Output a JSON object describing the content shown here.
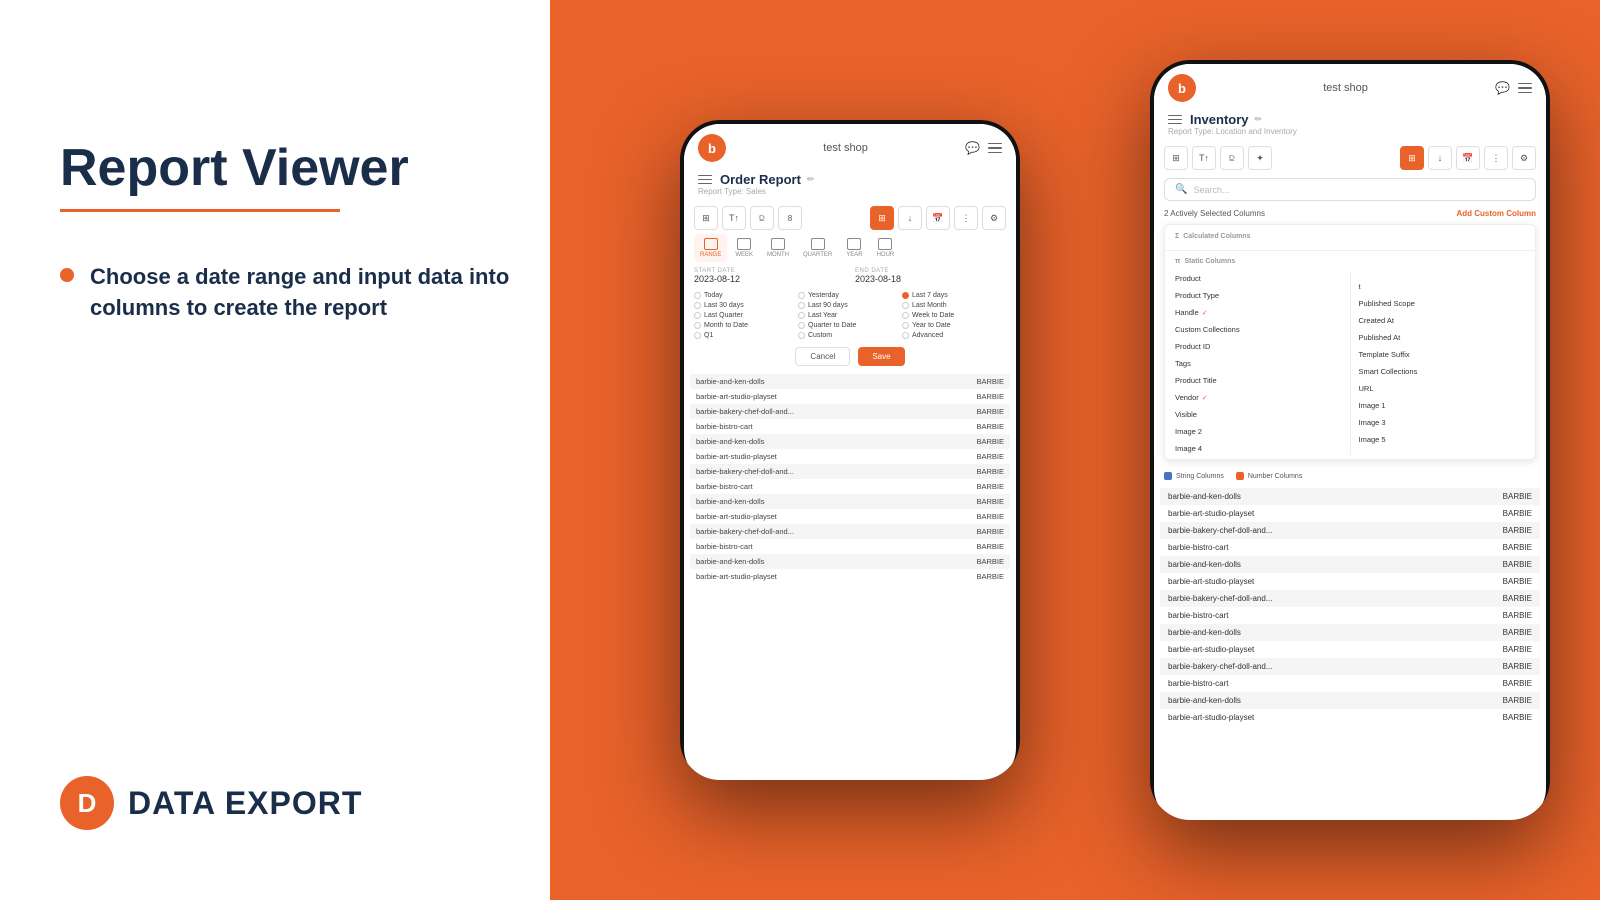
{
  "background": {
    "color": "#E8622A"
  },
  "left_panel": {
    "title": "Report Viewer",
    "underline_color": "#E8622A",
    "bullet": "Choose a date range and input data into columns to create the report",
    "logo_letter": "D",
    "logo_text": "DATA  EXPORT"
  },
  "phone_left": {
    "store_name": "test shop",
    "report_title": "Order Report",
    "report_subtitle": "Report Type: Sales",
    "toolbar_buttons": [
      "grid",
      "T",
      "filter",
      "8"
    ],
    "date_tabs": [
      "RANGE",
      "WEEK",
      "MONTH",
      "QUARTER",
      "YEAR",
      "HOUR"
    ],
    "start_date_label": "START DATE",
    "start_date_value": "2023-08-12",
    "end_date_label": "END DATE",
    "end_date_value": "2023-08-18",
    "radio_options": [
      [
        "Today",
        "Yesterday",
        "Last 7 days"
      ],
      [
        "Last 30 days",
        "Last 90 days",
        "Last Month"
      ],
      [
        "Last Quarter",
        "Last Year",
        "Week to Date"
      ],
      [
        "Month to Date",
        "Quarter to Date",
        "Year to Date"
      ],
      [
        "Q1",
        "Custom",
        "Advanced"
      ]
    ],
    "cancel_label": "Cancel",
    "save_label": "Save",
    "table_rows": [
      {
        "handle": "barbie-and-ken-dolls",
        "brand": "BARBIE"
      },
      {
        "handle": "barbie-art-studio-playset",
        "brand": "BARBIE"
      },
      {
        "handle": "barbie-bakery-chef-doll-and...",
        "brand": "BARBIE"
      },
      {
        "handle": "barbie-bistro-cart",
        "brand": "BARBIE"
      },
      {
        "handle": "barbie-and-ken-dolls",
        "brand": "BARBIE"
      },
      {
        "handle": "barbie-art-studio-playset",
        "brand": "BARBIE"
      },
      {
        "handle": "barbie-bakery-chef-doll-and...",
        "brand": "BARBIE"
      },
      {
        "handle": "barbie-bistro-cart",
        "brand": "BARBIE"
      },
      {
        "handle": "barbie-and-ken-dolls",
        "brand": "BARBIE"
      },
      {
        "handle": "barbie-art-studio-playset",
        "brand": "BARBIE"
      },
      {
        "handle": "barbie-bakery-chef-doll-and...",
        "brand": "BARBIE"
      },
      {
        "handle": "barbie-bistro-cart",
        "brand": "BARBIE"
      },
      {
        "handle": "barbie-and-ken-dolls",
        "brand": "BARBIE"
      },
      {
        "handle": "barbie-art-studio-playset",
        "brand": "BARBIE"
      }
    ]
  },
  "phone_right": {
    "store_name": "test shop",
    "report_title": "Inventory",
    "report_subtitle": "Report Type: Location and Inventory",
    "search_placeholder": "Search...",
    "active_columns_text": "2 Actively Selected Columns",
    "add_custom_label": "Add Custom Column",
    "dropdown": {
      "calculated_label": "Calculated Columns",
      "static_label": "Static Columns",
      "left_columns": [
        {
          "name": "Product",
          "checked": false
        },
        {
          "name": "Product Type",
          "checked": false
        },
        {
          "name": "Handle",
          "checked": true
        },
        {
          "name": "Custom Collections",
          "checked": false
        },
        {
          "name": "Product ID",
          "checked": false
        },
        {
          "name": "Tags",
          "checked": false
        },
        {
          "name": "Product Title",
          "checked": false
        },
        {
          "name": "Vendor",
          "checked": true
        },
        {
          "name": "Visible",
          "checked": false
        },
        {
          "name": "Image 2",
          "checked": false
        },
        {
          "name": "Image 4",
          "checked": false
        }
      ],
      "right_columns": [
        {
          "name": "",
          "checked": false
        },
        {
          "name": "t",
          "checked": false
        },
        {
          "name": "Published Scope",
          "checked": false
        },
        {
          "name": "Created At",
          "checked": false
        },
        {
          "name": "Published At",
          "checked": false
        },
        {
          "name": "Template Suffix",
          "checked": false
        },
        {
          "name": "Smart Collections",
          "checked": false
        },
        {
          "name": "URL",
          "checked": false
        },
        {
          "name": "Image 1",
          "checked": false
        },
        {
          "name": "Image 3",
          "checked": false
        },
        {
          "name": "Image 5",
          "checked": false
        }
      ]
    },
    "legend": {
      "string_label": "String Columns",
      "number_label": "Number Columns"
    },
    "table_rows": [
      {
        "handle": "barbie-and-ken-dolls",
        "brand": "BARBIE"
      },
      {
        "handle": "barbie-art-studio-playset",
        "brand": "BARBIE"
      },
      {
        "handle": "barbie-bakery-chef-doll-and...",
        "brand": "BARBIE"
      },
      {
        "handle": "barbie-bistro-cart",
        "brand": "BARBIE"
      },
      {
        "handle": "barbie-and-ken-dolls",
        "brand": "BARBIE"
      },
      {
        "handle": "barbie-art-studio-playset",
        "brand": "BARBIE"
      },
      {
        "handle": "barbie-bakery-chef-doll-and...",
        "brand": "BARBIE"
      },
      {
        "handle": "barbie-bistro-cart",
        "brand": "BARBIE"
      },
      {
        "handle": "barbie-and-ken-dolls",
        "brand": "BARBIE"
      },
      {
        "handle": "barbie-art-studio-playset",
        "brand": "BARBIE"
      },
      {
        "handle": "barbie-bakery-chef-doll-and...",
        "brand": "BARBIE"
      },
      {
        "handle": "barbie-bistro-cart",
        "brand": "BARBIE"
      },
      {
        "handle": "barbie-and-ken-dolls",
        "brand": "BARBIE"
      },
      {
        "handle": "barbie-art-studio-playset",
        "brand": "BARBIE"
      }
    ]
  }
}
